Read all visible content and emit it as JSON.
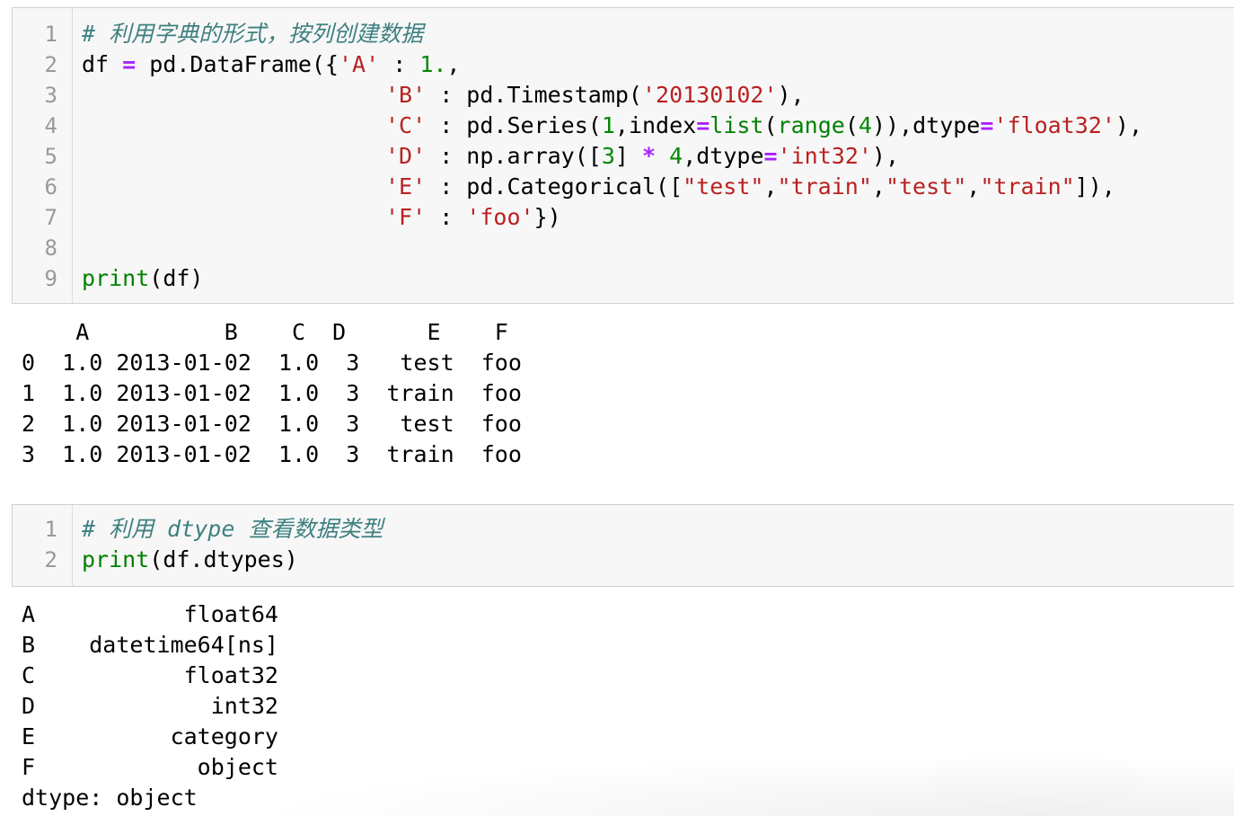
{
  "cell1": {
    "line_numbers": [
      "1",
      "2",
      "3",
      "4",
      "5",
      "6",
      "7",
      "8",
      "9"
    ],
    "l1_comment": "# 利用字典的形式，按列创建数据",
    "l2_a": "df ",
    "l2_op": "=",
    "l2_b": " pd.DataFrame({",
    "l2_key": "'A'",
    "l2_c": " : ",
    "l2_num": "1.",
    "l2_d": ",",
    "l3_key": "'B'",
    "l3_a": " : pd.Timestamp(",
    "l3_str": "'20130102'",
    "l3_b": "),",
    "l4_key": "'C'",
    "l4_a": " : pd.Series(",
    "l4_n1": "1",
    "l4_b": ",index",
    "l4_op": "=",
    "l4_list": "list",
    "l4_c": "(",
    "l4_range": "range",
    "l4_d": "(",
    "l4_n2": "4",
    "l4_e": ")),dtype",
    "l4_op2": "=",
    "l4_str": "'float32'",
    "l4_f": "),",
    "l5_key": "'D'",
    "l5_a": " : np.array([",
    "l5_n1": "3",
    "l5_b": "] ",
    "l5_op": "*",
    "l5_c": " ",
    "l5_n2": "4",
    "l5_d": ",dtype",
    "l5_op2": "=",
    "l5_str": "'int32'",
    "l5_e": "),",
    "l6_key": "'E'",
    "l6_a": " : pd.Categorical([",
    "l6_s1": "\"test\"",
    "l6_c1": ",",
    "l6_s2": "\"train\"",
    "l6_c2": ",",
    "l6_s3": "\"test\"",
    "l6_c3": ",",
    "l6_s4": "\"train\"",
    "l6_b": "]),",
    "l7_key": "'F'",
    "l7_a": " : ",
    "l7_str": "'foo'",
    "l7_b": "})",
    "l9_print": "print",
    "l9_rest": "(df)"
  },
  "output1": {
    "lines": [
      "    A          B    C  D      E    F",
      "0  1.0 2013-01-02  1.0  3   test  foo",
      "1  1.0 2013-01-02  1.0  3  train  foo",
      "2  1.0 2013-01-02  1.0  3   test  foo",
      "3  1.0 2013-01-02  1.0  3  train  foo"
    ]
  },
  "cell2": {
    "line_numbers": [
      "1",
      "2"
    ],
    "l1_comment": "# 利用 dtype 查看数据类型",
    "l2_print": "print",
    "l2_rest": "(df.dtypes)"
  },
  "output2": {
    "lines": [
      "A           float64",
      "B    datetime64[ns]",
      "C           float32",
      "D             int32",
      "E          category",
      "F            object",
      "dtype: object"
    ]
  },
  "colors": {
    "comment": "#408080",
    "string": "#ba2121",
    "number": "#008800",
    "operator": "#aa22ff",
    "builtin": "#008000",
    "cell_background": "#f7f7f7",
    "line_number": "#999999"
  }
}
